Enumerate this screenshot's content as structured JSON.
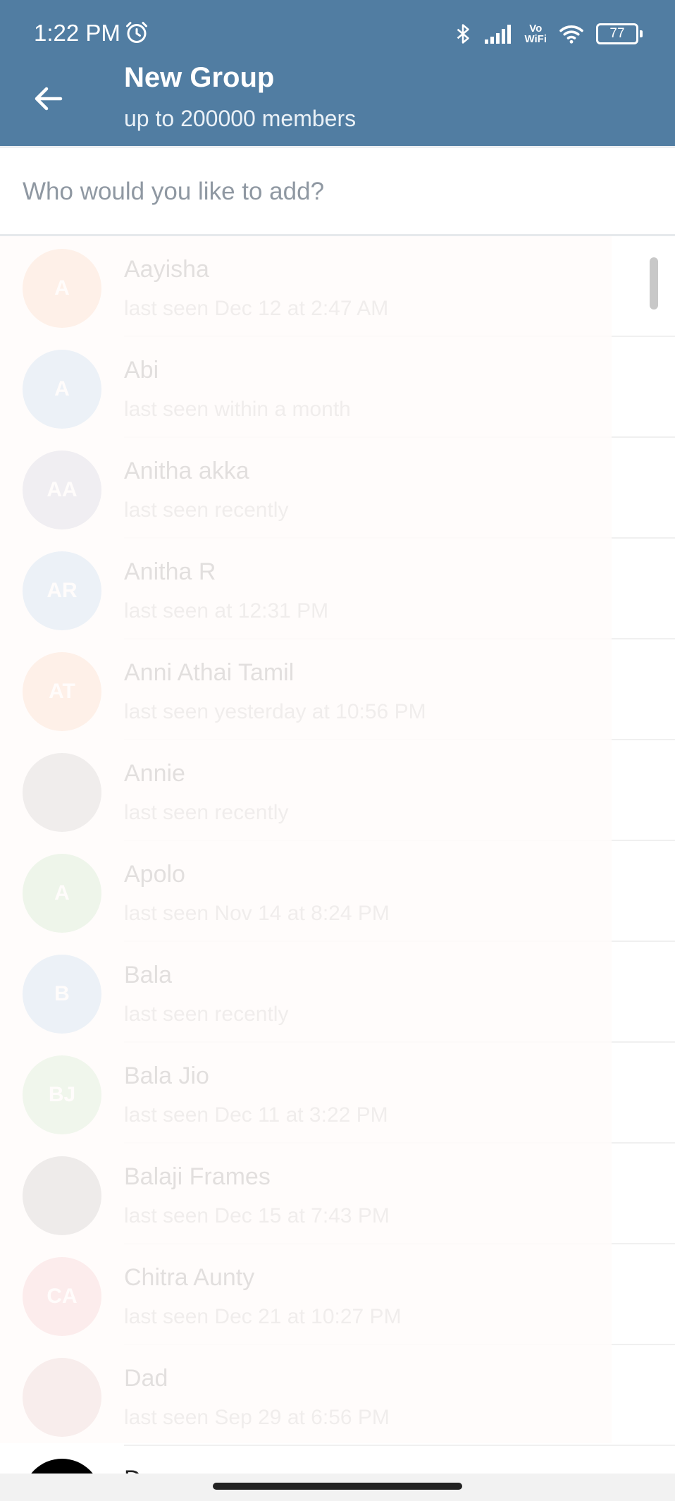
{
  "status_bar": {
    "time": "1:22 PM",
    "vowifi_top": "Vo",
    "vowifi_bottom": "WiFi",
    "battery": "77",
    "icons": [
      "alarm-icon",
      "bluetooth-icon",
      "signal-icon",
      "wifi-icon",
      "battery-icon"
    ]
  },
  "header": {
    "title": "New Group",
    "subtitle": "up to 200000 members",
    "back_icon": "arrow-back-icon",
    "background_color": "#517da2"
  },
  "search": {
    "placeholder": "Who would you like to add?",
    "value": ""
  },
  "contacts": [
    {
      "initials": "A",
      "name": "Aayisha",
      "status": "last seen Dec 12 at 2:47 AM",
      "avatar_color": "#f2a26c"
    },
    {
      "initials": "A",
      "name": "Abi",
      "status": "last seen within a month",
      "avatar_color": "#6aa9de"
    },
    {
      "initials": "AA",
      "name": "Anitha akka",
      "status": "last seen recently",
      "avatar_color": "#8a95b8"
    },
    {
      "initials": "AR",
      "name": "Anitha R",
      "status": "last seen at 12:31 PM",
      "avatar_color": "#6aa9de"
    },
    {
      "initials": "AT",
      "name": "Anni Athai Tamil",
      "status": "last seen yesterday at 10:56 PM",
      "avatar_color": "#f2a26c"
    },
    {
      "initials": "",
      "name": "Annie",
      "status": "last seen recently",
      "avatar_color": "#8f8f8f"
    },
    {
      "initials": "A",
      "name": "Apolo",
      "status": "last seen Nov 14 at 8:24 PM",
      "avatar_color": "#7fc97a"
    },
    {
      "initials": "B",
      "name": "Bala",
      "status": "last seen recently",
      "avatar_color": "#6aa9de"
    },
    {
      "initials": "BJ",
      "name": "Bala Jio",
      "status": "last seen Dec 11 at 3:22 PM",
      "avatar_color": "#8fd08a"
    },
    {
      "initials": "",
      "name": "Balaji Frames",
      "status": "last seen Dec 15 at 7:43 PM",
      "avatar_color": "#7d7d7d"
    },
    {
      "initials": "CA",
      "name": "Chitra Aunty",
      "status": "last seen Dec 21 at 10:27 PM",
      "avatar_color": "#e8868b"
    },
    {
      "initials": "",
      "name": "Dad",
      "status": "last seen Sep 29 at 6:56 PM",
      "avatar_color": "#c48a8a"
    },
    {
      "initials": "",
      "name": "D",
      "status": "",
      "avatar_color": "#000000"
    }
  ]
}
